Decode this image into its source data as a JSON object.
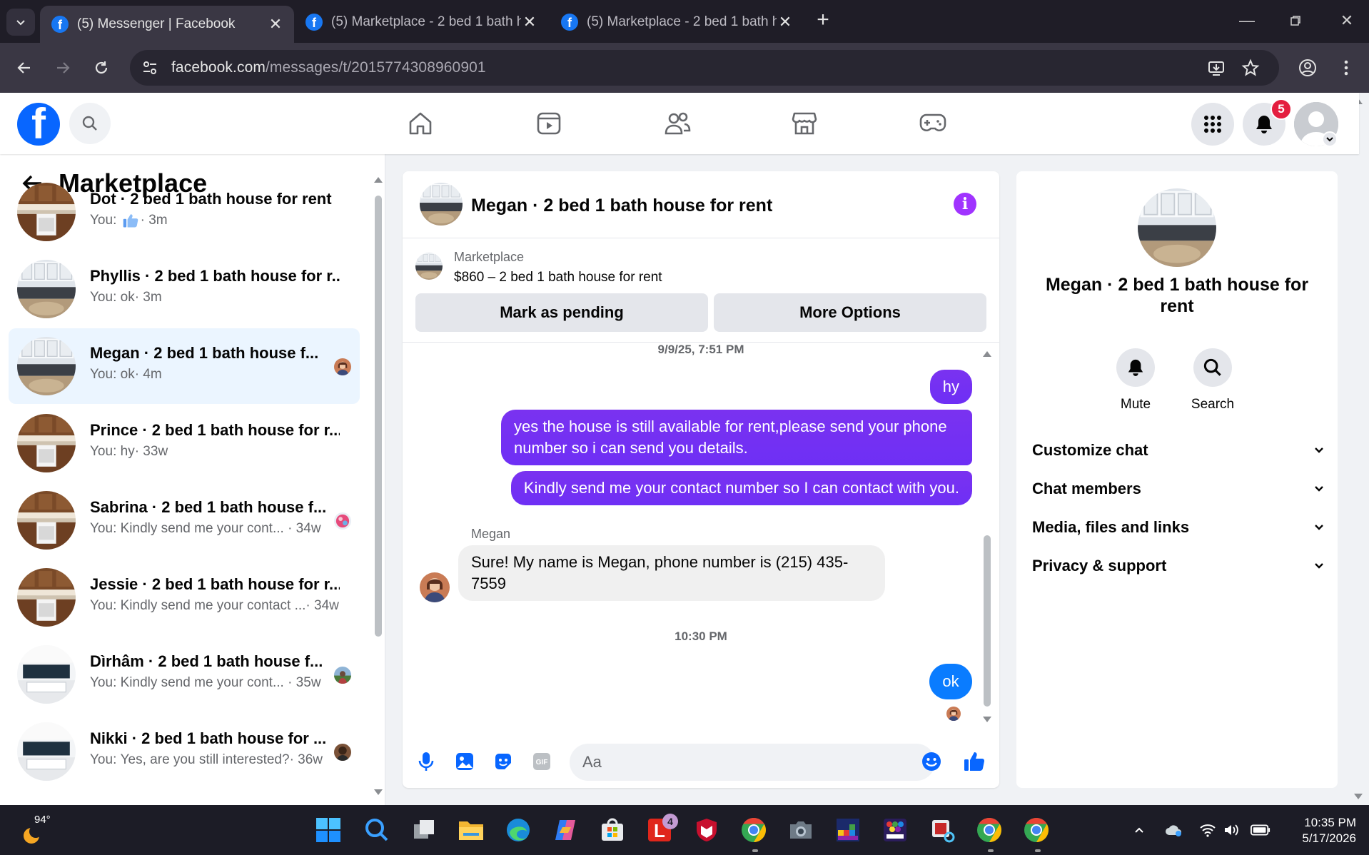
{
  "browser": {
    "tabs": [
      {
        "title": "(5) Messenger | Facebook",
        "active": true
      },
      {
        "title": "(5) Marketplace - 2 bed 1 bath h",
        "active": false
      },
      {
        "title": "(5) Marketplace - 2 bed 1 bath h",
        "active": false
      }
    ],
    "url_domain": "facebook.com",
    "url_path": "/messages/t/2015774308960901"
  },
  "fb": {
    "notification_count": "5"
  },
  "left": {
    "title": "Marketplace",
    "conversations": [
      {
        "name": "Dot · 2 bed 1 bath house for rent",
        "sub_prefix": "You: ",
        "sub_text": "",
        "like": true,
        "time": "· 3m",
        "selected": false,
        "photo": "kitchen-wood",
        "mini": ""
      },
      {
        "name": "Phyllis · 2 bed 1 bath house for r...",
        "sub_prefix": "You: ",
        "sub_text": "ok",
        "like": false,
        "time": "· 3m",
        "selected": false,
        "photo": "kitchen-white",
        "mini": ""
      },
      {
        "name": "Megan · 2 bed 1 bath house f...",
        "sub_prefix": "You: ",
        "sub_text": "ok",
        "like": false,
        "time": "· 4m",
        "selected": true,
        "photo": "kitchen-white",
        "mini": "woman"
      },
      {
        "name": "Prince · 2 bed 1 bath house for r...",
        "sub_prefix": "You: ",
        "sub_text": "hy",
        "like": false,
        "time": "· 33w",
        "selected": false,
        "photo": "kitchen-wood",
        "mini": ""
      },
      {
        "name": "Sabrina · 2 bed 1 bath house f...",
        "sub_prefix": "You: ",
        "sub_text": "Kindly send me your cont...",
        "like": false,
        "time": " · 34w",
        "selected": false,
        "photo": "kitchen-wood",
        "mini": "pink"
      },
      {
        "name": "Jessie · 2 bed 1 bath house for r...",
        "sub_prefix": "You: ",
        "sub_text": "Kindly send me your contact ...",
        "like": false,
        "time": "· 34w",
        "selected": false,
        "photo": "kitchen-wood",
        "mini": ""
      },
      {
        "name": "Dìrhâm · 2 bed 1 bath house f...",
        "sub_prefix": "You: ",
        "sub_text": "Kindly send me your cont...",
        "like": false,
        "time": " · 35w",
        "selected": false,
        "photo": "kitchen-dark",
        "mini": "outdoor"
      },
      {
        "name": "Nikki · 2 bed 1 bath house for ...",
        "sub_prefix": "You: ",
        "sub_text": "Yes, are you still interested?",
        "like": false,
        "time": "· 36w",
        "selected": false,
        "photo": "kitchen-dark",
        "mini": "man"
      }
    ]
  },
  "chat": {
    "title": "Megan · 2 bed 1 bath house for rent",
    "marketplace_label": "Marketplace",
    "listing": "$860 – 2 bed 1 bath house for rent",
    "btn_pending": "Mark as pending",
    "btn_more": "More Options",
    "timestamp1": "9/9/25, 7:51 PM",
    "msg_hy": "hy",
    "msg_available": "yes the house is still available for rent,please send your phone number so i can send you details.",
    "msg_kindly": "Kindly send me your contact number so I can contact with you.",
    "sender_name": "Megan",
    "msg_reply": "Sure! My name is Megan, phone number is (215) 435-7559",
    "timestamp2": "10:30 PM",
    "msg_ok": "ok",
    "composer_placeholder": "Aa"
  },
  "right": {
    "title": "Megan · 2 bed 1 bath house for rent",
    "mute": "Mute",
    "search": "Search",
    "rows": [
      "Customize chat",
      "Chat members",
      "Media, files and links",
      "Privacy & support"
    ]
  },
  "taskbar": {
    "temp": "94°",
    "time": "10:35 PM",
    "date": "5/17/2026",
    "badge_l": "4"
  },
  "colors": {
    "fb_blue": "#0866ff",
    "my_bubble": "#7a32f0",
    "badge_red": "#e41e3f"
  }
}
